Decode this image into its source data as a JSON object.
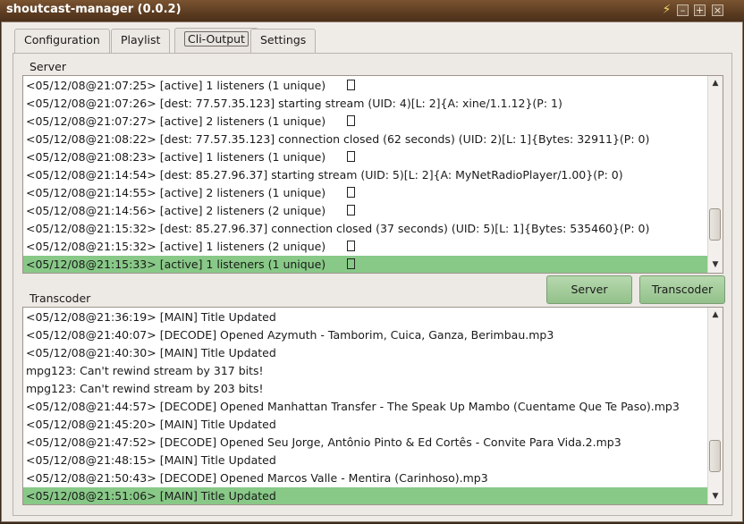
{
  "window": {
    "title": "shoutcast-manager (0.0.2)",
    "controls": {
      "app": "⚡",
      "minimize": "–",
      "maximize": "+",
      "close": "×"
    }
  },
  "tabs": [
    "Configuration",
    "Playlist",
    "Cli-Output",
    "Settings"
  ],
  "active_tab": "Cli-Output",
  "server": {
    "label": "Server",
    "lines": [
      "<05/12/08@21:07:25> [active] 1 listeners (1 unique)",
      "<05/12/08@21:07:26> [dest: 77.57.35.123] starting stream (UID: 4)[L: 2]{A: xine/1.1.12}(P: 1)",
      "<05/12/08@21:07:27> [active] 2 listeners (1 unique)",
      "<05/12/08@21:08:22> [dest: 77.57.35.123] connection closed (62 seconds) (UID: 2)[L: 1]{Bytes: 32911}(P: 0)",
      "<05/12/08@21:08:23> [active] 1 listeners (1 unique)",
      "<05/12/08@21:14:54> [dest: 85.27.96.37] starting stream (UID: 5)[L: 2]{A: MyNetRadioPlayer/1.00}(P: 0)",
      "<05/12/08@21:14:55> [active] 2 listeners (1 unique)",
      "<05/12/08@21:14:56> [active] 2 listeners (2 unique)",
      "<05/12/08@21:15:32> [dest: 85.27.96.37] connection closed (37 seconds) (UID: 5)[L: 1]{Bytes: 535460}(P: 0)",
      "<05/12/08@21:15:32> [active] 1 listeners (2 unique)",
      "<05/12/08@21:15:33> [active] 1 listeners (1 unique)"
    ]
  },
  "buttons": {
    "server": "Server",
    "transcoder": "Transcoder"
  },
  "transcoder": {
    "label": "Transcoder",
    "lines": [
      "<05/12/08@21:36:19> [MAIN] Title Updated",
      "<05/12/08@21:40:07> [DECODE] Opened Azymuth - Tamborim, Cuica, Ganza, Berimbau.mp3",
      "<05/12/08@21:40:30> [MAIN] Title Updated",
      "mpg123: Can't rewind stream by 317 bits!",
      "mpg123: Can't rewind stream by 203 bits!",
      "<05/12/08@21:44:57> [DECODE] Opened Manhattan Transfer - The Speak Up Mambo (Cuentame Que Te Paso).mp3",
      "<05/12/08@21:45:20> [MAIN] Title Updated",
      "<05/12/08@21:47:52> [DECODE] Opened Seu Jorge, Antônio Pinto & Ed Cortês - Convite Para Vida.2.mp3",
      "<05/12/08@21:48:15> [MAIN] Title Updated",
      "<05/12/08@21:50:43> [DECODE] Opened Marcos Valle - Mentira (Carinhoso).mp3",
      "<05/12/08@21:51:06> [MAIN] Title Updated"
    ]
  }
}
